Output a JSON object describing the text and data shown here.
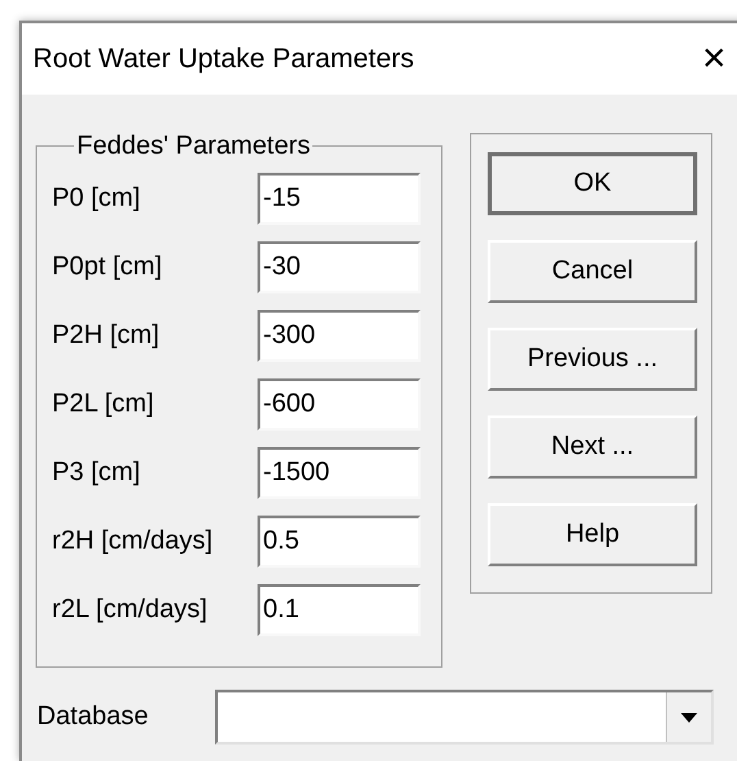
{
  "window": {
    "title": "Root Water Uptake Parameters",
    "close": "×"
  },
  "feddes": {
    "title": "Feddes' Parameters",
    "fields": [
      {
        "label": "P0 [cm]",
        "value": "-15"
      },
      {
        "label": "P0pt [cm]",
        "value": "-30"
      },
      {
        "label": "P2H [cm]",
        "value": "-300"
      },
      {
        "label": "P2L [cm]",
        "value": "-600"
      },
      {
        "label": "P3 [cm]",
        "value": "-1500"
      },
      {
        "label": "r2H [cm/days]",
        "value": "0.5"
      },
      {
        "label": "r2L [cm/days]",
        "value": "0.1"
      }
    ]
  },
  "buttons": [
    {
      "label": "OK",
      "default": true
    },
    {
      "label": "Cancel",
      "default": false
    },
    {
      "label": "Previous ...",
      "default": false
    },
    {
      "label": "Next ...",
      "default": false
    },
    {
      "label": "Help",
      "default": false
    }
  ],
  "database": {
    "label": "Database"
  }
}
